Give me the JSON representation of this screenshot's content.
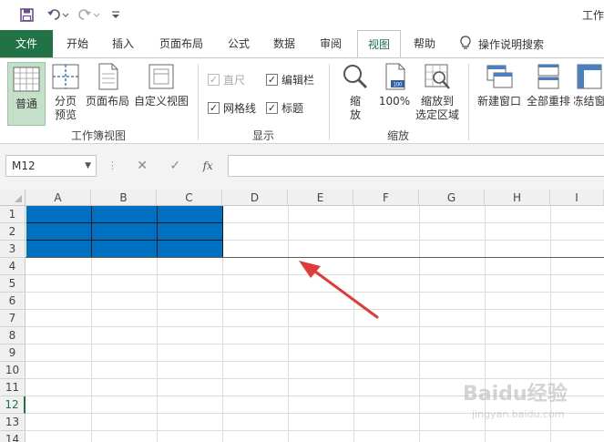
{
  "window": {
    "title_fragment": "工作"
  },
  "tabs": [
    {
      "label": "文件"
    },
    {
      "label": "开始"
    },
    {
      "label": "插入"
    },
    {
      "label": "页面布局"
    },
    {
      "label": "公式"
    },
    {
      "label": "数据"
    },
    {
      "label": "审阅"
    },
    {
      "label": "视图"
    },
    {
      "label": "帮助"
    }
  ],
  "tell_me": {
    "label": "操作说明搜索"
  },
  "ribbon": {
    "workbook_views": {
      "label": "工作簿视图",
      "normal": "普通",
      "page_break_line1": "分页",
      "page_break_line2": "预览",
      "page_layout": "页面布局",
      "custom_views": "自定义视图"
    },
    "show": {
      "label": "显示",
      "ruler": "直尺",
      "formula_bar": "编辑栏",
      "gridlines": "网格线",
      "headings": "标题"
    },
    "zoom": {
      "label": "缩放",
      "zoom_line1": "缩",
      "zoom_line2": "放",
      "zoom100": "100%",
      "zoom100_icon_text": "100",
      "zoom_sel_line1": "缩放到",
      "zoom_sel_line2": "选定区域"
    },
    "window": {
      "new_window": "新建窗口",
      "arrange_all": "全部重排",
      "freeze": "冻结窗"
    }
  },
  "formula_bar": {
    "name_box": "M12",
    "fx": "fx"
  },
  "columns": [
    "A",
    "B",
    "C",
    "D",
    "E",
    "F",
    "G",
    "H",
    "I"
  ],
  "rows": [
    "1",
    "2",
    "3",
    "4",
    "5",
    "6",
    "7",
    "8",
    "9",
    "10",
    "11",
    "12",
    "13",
    "14"
  ],
  "selected_row": "12",
  "colors": {
    "excel_green": "#217346",
    "fill_blue": "#0070c0",
    "arrow_red": "#e03a3a"
  },
  "watermark": {
    "text": "Baidu经验",
    "sub": "jingyan.baidu.com"
  }
}
